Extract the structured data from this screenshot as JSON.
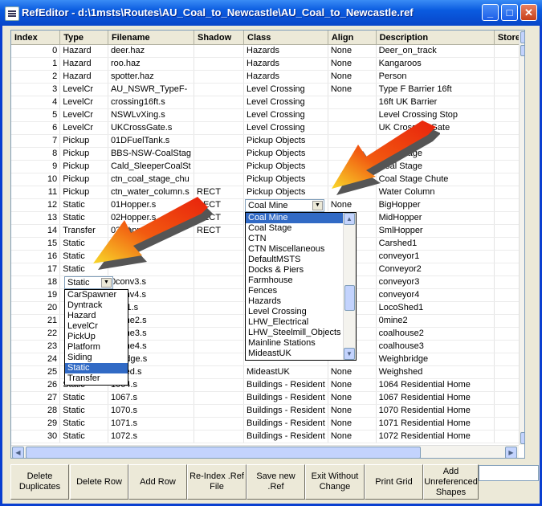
{
  "window": {
    "title": "RefEditor - d:\\1msts\\Routes\\AU_Coal_to_Newcastle\\AU_Coal_to_Newcastle.ref",
    "minimize_icon": "minimize-icon",
    "maximize_icon": "maximize-icon",
    "close_icon": "close-icon"
  },
  "grid": {
    "columns": [
      "Index",
      "Type",
      "Filename",
      "Shadow",
      "Class",
      "Align",
      "Description",
      "Store"
    ],
    "rows": [
      {
        "index": "0",
        "type": "Hazard",
        "filename": "deer.haz",
        "shadow": "",
        "class": "Hazards",
        "align": "None",
        "description": "Deer_on_track"
      },
      {
        "index": "1",
        "type": "Hazard",
        "filename": "roo.haz",
        "shadow": "",
        "class": "Hazards",
        "align": "None",
        "description": "Kangaroos"
      },
      {
        "index": "2",
        "type": "Hazard",
        "filename": "spotter.haz",
        "shadow": "",
        "class": "Hazards",
        "align": "None",
        "description": "Person"
      },
      {
        "index": "3",
        "type": "LevelCr",
        "filename": "AU_NSWR_TypeF-",
        "shadow": "",
        "class": "Level Crossing",
        "align": "None",
        "description": "Type F Barrier 16ft"
      },
      {
        "index": "4",
        "type": "LevelCr",
        "filename": "crossing16ft.s",
        "shadow": "",
        "class": "Level Crossing",
        "align": "",
        "description": "16ft UK Barrier"
      },
      {
        "index": "5",
        "type": "LevelCr",
        "filename": "NSWLvXing.s",
        "shadow": "",
        "class": "Level Crossing",
        "align": "",
        "description": "Level Crossing Stop"
      },
      {
        "index": "6",
        "type": "LevelCr",
        "filename": "UKCrossGate.s",
        "shadow": "",
        "class": "Level Crossing",
        "align": "",
        "description": "UK Crossing Gate"
      },
      {
        "index": "7",
        "type": "Pickup",
        "filename": "01DFuelTank.s",
        "shadow": "",
        "class": "Pickup Objects",
        "align": "",
        "description": ""
      },
      {
        "index": "8",
        "type": "Pickup",
        "filename": "BBS-NSW-CoalStag",
        "shadow": "",
        "class": "Pickup Objects",
        "align": "",
        "description": "Coal Stage"
      },
      {
        "index": "9",
        "type": "Pickup",
        "filename": "Cald_SleeperCoalSt",
        "shadow": "",
        "class": "Pickup Objects",
        "align": "",
        "description": "Coal Stage"
      },
      {
        "index": "10",
        "type": "Pickup",
        "filename": "ctn_coal_stage_chu",
        "shadow": "",
        "class": "Pickup Objects",
        "align": "",
        "description": "Coal Stage Chute"
      },
      {
        "index": "11",
        "type": "Pickup",
        "filename": "ctn_water_column.s",
        "shadow": "RECT",
        "class": "Pickup Objects",
        "align": "",
        "description": "Water Column"
      },
      {
        "index": "12",
        "type": "Static",
        "filename": "01Hopper.s",
        "shadow": "RECT",
        "class": "",
        "align": "None",
        "description": "BigHopper"
      },
      {
        "index": "13",
        "type": "Static",
        "filename": "02Hopper.s",
        "shadow": "RECT",
        "class": "",
        "align": "",
        "description": "MidHopper"
      },
      {
        "index": "14",
        "type": "Transfer",
        "filename": "03Hopper.s",
        "shadow": "RECT",
        "class": "",
        "align": "",
        "description": "SmlHopper"
      },
      {
        "index": "15",
        "type": "Static",
        "filename": "",
        "shadow": "",
        "class": "",
        "align": "",
        "description": "Carshed1"
      },
      {
        "index": "16",
        "type": "Static",
        "filename": "",
        "shadow": "",
        "class": "",
        "align": "",
        "description": "conveyor1"
      },
      {
        "index": "17",
        "type": "Static",
        "filename": "",
        "shadow": "",
        "class": "",
        "align": "",
        "description": "Conveyor2"
      },
      {
        "index": "18",
        "type": "",
        "filename": "0conv3.s",
        "shadow": "",
        "class": "",
        "align": "",
        "description": "conveyor3"
      },
      {
        "index": "19",
        "type": "",
        "filename": "0conv4.s",
        "shadow": "",
        "class": "",
        "align": "",
        "description": "conveyor4"
      },
      {
        "index": "20",
        "type": "",
        "filename": "0Sh1.s",
        "shadow": "",
        "class": "",
        "align": "",
        "description": "LocoShed1"
      },
      {
        "index": "21",
        "type": "",
        "filename": "0mine2.s",
        "shadow": "",
        "class": "",
        "align": "",
        "description": "0mine2"
      },
      {
        "index": "22",
        "type": "",
        "filename": "0mine3.s",
        "shadow": "",
        "class": "",
        "align": "",
        "description": "coalhouse2"
      },
      {
        "index": "23",
        "type": "",
        "filename": "0mine4.s",
        "shadow": "",
        "class": "",
        "align": "",
        "description": "coalhouse3"
      },
      {
        "index": "24",
        "type": "",
        "filename": "0bridge.s",
        "shadow": "",
        "class": "",
        "align": "",
        "description": "Weighbridge"
      },
      {
        "index": "25",
        "type": "",
        "filename": "0shed.s",
        "shadow": "",
        "class": "MideastUK",
        "align": "None",
        "description": "Weighshed"
      },
      {
        "index": "26",
        "type": "Static",
        "filename": "1064.s",
        "shadow": "",
        "class": "Buildings - Resident",
        "align": "None",
        "description": "1064 Residential Home"
      },
      {
        "index": "27",
        "type": "Static",
        "filename": "1067.s",
        "shadow": "",
        "class": "Buildings - Resident",
        "align": "None",
        "description": "1067 Residential Home"
      },
      {
        "index": "28",
        "type": "Static",
        "filename": "1070.s",
        "shadow": "",
        "class": "Buildings - Resident",
        "align": "None",
        "description": "1070 Residential Home"
      },
      {
        "index": "29",
        "type": "Static",
        "filename": "1071.s",
        "shadow": "",
        "class": "Buildings - Resident",
        "align": "None",
        "description": "1071 Residential Home"
      },
      {
        "index": "30",
        "type": "Static",
        "filename": "1072.s",
        "shadow": "",
        "class": "Buildings - Resident",
        "align": "None",
        "description": "1072 Residential Home"
      }
    ]
  },
  "type_editor": {
    "value": "Static",
    "options": [
      "CarSpawner",
      "Dyntrack",
      "Hazard",
      "LevelCr",
      "PickUp",
      "Platform",
      "Siding",
      "Static",
      "Transfer"
    ],
    "selected": "Static"
  },
  "class_editor": {
    "value": "Coal Mine",
    "options": [
      "Coal Mine",
      "Coal Stage",
      "CTN",
      "CTN Miscellaneous",
      "DefaultMSTS",
      "Docks & Piers",
      "Farmhouse",
      "Fences",
      "Hazards",
      "Level Crossing",
      "LHW_Electrical",
      "LHW_Steelmill_Objects",
      "Mainline Stations",
      "MideastUK"
    ],
    "selected": "Coal Mine"
  },
  "buttons": {
    "delete_duplicates": "Delete Duplicates",
    "delete_row": "Delete Row",
    "add_row": "Add Row",
    "reindex": "Re-Index .Ref File",
    "save_new": "Save new .Ref",
    "exit_without_change": "Exit Without Change",
    "print_grid": "Print Grid",
    "add_unreferenced": "Add Unreferenced Shapes"
  },
  "colors": {
    "selection": "#316ac5",
    "arrow_red": "#e8210c",
    "arrow_yellow": "#f8d82a"
  }
}
